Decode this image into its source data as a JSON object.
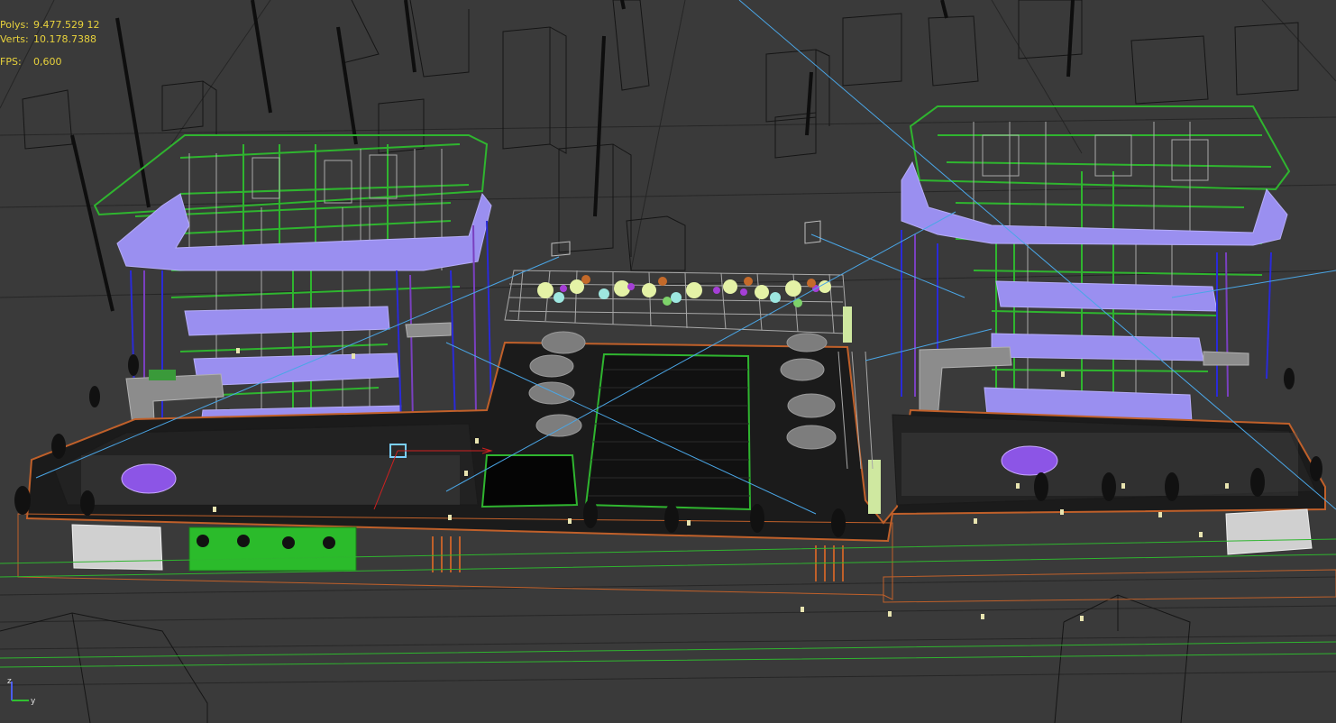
{
  "viewport": {
    "background": "#3a3a3a",
    "stats": {
      "polys_label": "Polys:",
      "polys_value": "9.477.529  12",
      "verts_label": "Verts:",
      "verts_value": "10.178.7388",
      "fps_label": "FPS:",
      "fps_value": "0,600"
    },
    "axis": {
      "z_label": "z",
      "y_label": "y"
    }
  },
  "colors": {
    "grid": "#262626",
    "wire_black": "#141414",
    "wire_green": "#2fb52f",
    "wire_lavender": "#9a8ff0",
    "wire_purple": "#7a40c0",
    "wire_blue": "#2a2ad8",
    "wire_orange": "#b8552a",
    "wire_gray": "#a8a8a8",
    "light_line": "#4aa6e6",
    "stats_text": "#e8d23c"
  }
}
